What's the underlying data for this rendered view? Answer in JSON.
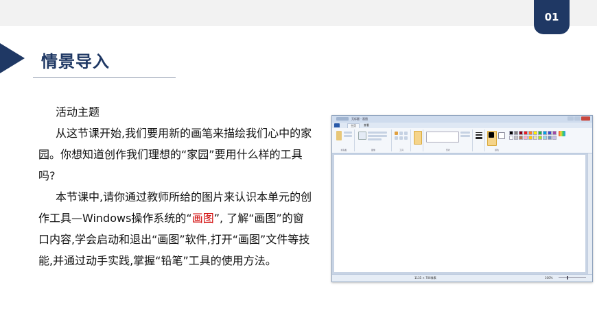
{
  "page_number": "01",
  "title": "情景导入",
  "heading": "活动主题",
  "paragraphs": {
    "p1": "从这节课开始,我们要用新的画笔来描绘我们心中的家园。你想知道创作我们理想的“家园”要用什么样的工具吗?",
    "p2_before": "本节课中,请你通过教师所给的图片来认识本单元的创作工具—Windows操作系统的“",
    "p2_highlight": "画图",
    "p2_after": "”, 了解“画图”的窗口内容,学会启动和退出“画图”软件,打开“画图”文件等技能,并通过动手实践,掌握“铅笔”工具的使用方法。"
  },
  "paint_window": {
    "title": "无标题 - 画图",
    "tabs": [
      "",
      "主页",
      "查看"
    ],
    "groups": [
      "剪贴板",
      "图像",
      "工具",
      "形状",
      "颜色"
    ],
    "status_size": "1135 × 706像素",
    "zoom": "100%"
  },
  "colors": {
    "accent": "#1f3864",
    "highlight": "#d00000",
    "palette": [
      "#000000",
      "#7f7f7f",
      "#880015",
      "#ed1c24",
      "#ff7f27",
      "#fff200",
      "#22b14c",
      "#00a2e8",
      "#3f48cc",
      "#a349a4",
      "#ffffff",
      "#c3c3c3",
      "#b97a57",
      "#ffaec9",
      "#ffc90e",
      "#efe4b0",
      "#b5e61d",
      "#99d9ea",
      "#7092be",
      "#c8bfe7"
    ]
  }
}
